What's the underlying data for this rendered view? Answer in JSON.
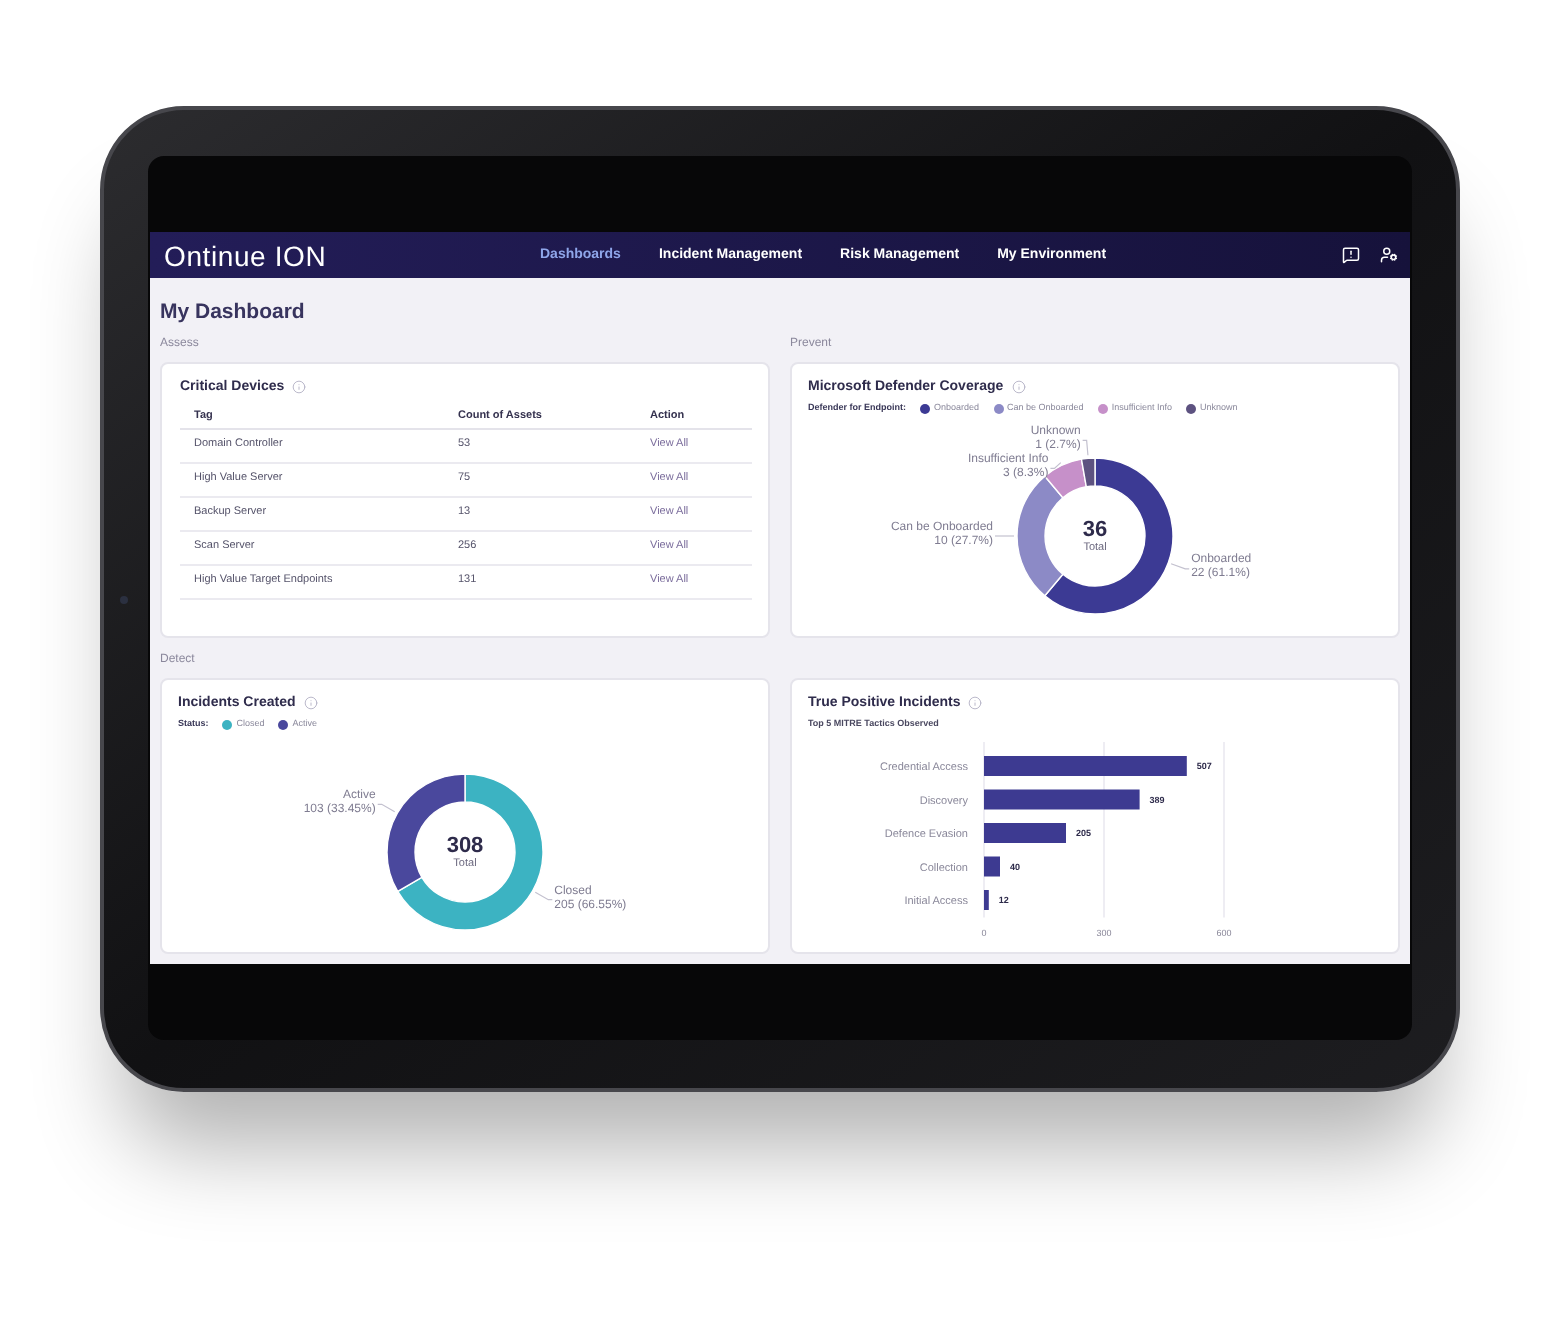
{
  "nav": {
    "logo": "Ontinue ION",
    "items": [
      {
        "label": "Dashboards",
        "selected": true
      },
      {
        "label": "Incident Management",
        "selected": false
      },
      {
        "label": "Risk Management",
        "selected": false
      },
      {
        "label": "My Environment",
        "selected": false
      }
    ]
  },
  "title": "My Dashboard",
  "cards": [
    {
      "section": "Assess",
      "kind": "table",
      "title": "Critical Devices",
      "columns": [
        "Tag",
        "Count of Assets",
        "Action"
      ],
      "rows": [
        {
          "tag": "Domain Controller",
          "count": "53",
          "action": "View All"
        },
        {
          "tag": "High Value Server",
          "count": "75",
          "action": "View All"
        },
        {
          "tag": "Backup Server",
          "count": "13",
          "action": "View All"
        },
        {
          "tag": "Scan Server",
          "count": "256",
          "action": "View All"
        },
        {
          "tag": "High Value Target Endpoints",
          "count": "131",
          "action": "View All"
        }
      ]
    },
    {
      "section": "Prevent",
      "kind": "donut",
      "title": "Microsoft Defender Coverage",
      "legend": {
        "title": "Defender for Endpoint:",
        "items": [
          {
            "label": "Onboarded",
            "color": "#3c3a94"
          },
          {
            "label": "Can be Onboarded",
            "color": "#8c8ac6"
          },
          {
            "label": "Insufficient Info",
            "color": "#c690c9"
          },
          {
            "label": "Unknown",
            "color": "#5d5280"
          }
        ]
      },
      "center": {
        "value": "36",
        "label": "Total"
      },
      "chart_data": {
        "type": "donut",
        "categories": [
          "Onboarded",
          "Can be Onboarded",
          "Insufficient Info",
          "Unknown"
        ],
        "values": [
          22,
          10,
          3,
          1
        ],
        "value_labels": [
          "22 (61.1%)",
          "10 (27.7%)",
          "3 (8.3%)",
          "1 (2.7%)"
        ]
      }
    },
    {
      "section": "Detect",
      "kind": "donut",
      "title": "Incidents Created",
      "legend": {
        "title": "Status:",
        "items": [
          {
            "label": "Closed",
            "color": "#3cb3c2"
          },
          {
            "label": "Active",
            "color": "#4a489d"
          }
        ]
      },
      "center": {
        "value": "308",
        "label": "Total"
      },
      "chart_data": {
        "type": "donut",
        "categories": [
          "Closed",
          "Active"
        ],
        "values": [
          205,
          103
        ],
        "value_labels": [
          "205 (66.55%)",
          "103 (33.45%)"
        ]
      }
    },
    {
      "kind": "bar",
      "title": "True Positive Incidents",
      "subtitle": "Top 5 MITRE Tactics Observed",
      "chart_data": {
        "type": "bar",
        "orientation": "horizontal",
        "categories": [
          "Credential Access",
          "Discovery",
          "Defence Evasion",
          "Collection",
          "Initial Access"
        ],
        "values": [
          507,
          389,
          205,
          40,
          12
        ],
        "xlim": [
          0,
          600
        ],
        "xticks": [
          0,
          300,
          600
        ],
        "data_labels": true
      }
    }
  ]
}
